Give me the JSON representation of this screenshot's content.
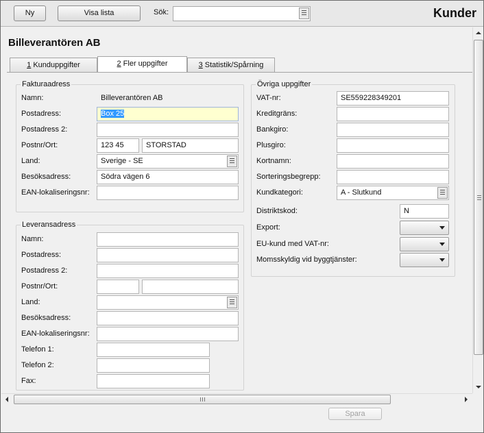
{
  "toolbar": {
    "new_label": "Ny",
    "show_list_label": "Visa lista",
    "search_label": "Sök:",
    "search_value": "",
    "title": "Kunder"
  },
  "customer_name": "Billeverantören AB",
  "tabs": [
    {
      "key": "1",
      "label": " Kunduppgifter"
    },
    {
      "key": "2",
      "label": " Fler uppgifter"
    },
    {
      "key": "3",
      "label": " Statistik/Spårning"
    }
  ],
  "faktura": {
    "title": "Fakturaadress",
    "namn_label": "Namn:",
    "namn_value": "Billeverantören AB",
    "postadress_label": "Postadress:",
    "postadress_value": "Box 25",
    "postadress2_label": "Postadress 2:",
    "postadress2_value": "",
    "postnr_label": "Postnr/Ort:",
    "postnr_value": "123 45",
    "ort_value": "STORSTAD",
    "land_label": "Land:",
    "land_value": "Sverige - SE",
    "besok_label": "Besöksadress:",
    "besok_value": "Södra vägen 6",
    "ean_label": "EAN-lokaliseringsnr:",
    "ean_value": ""
  },
  "leverans": {
    "title": "Leveransadress",
    "namn_label": "Namn:",
    "postadress_label": "Postadress:",
    "postadress2_label": "Postadress 2:",
    "postnr_label": "Postnr/Ort:",
    "land_label": "Land:",
    "besok_label": "Besöksadress:",
    "ean_label": "EAN-lokaliseringsnr:",
    "tel1_label": "Telefon 1:",
    "tel2_label": "Telefon 2:",
    "fax_label": "Fax:"
  },
  "ovriga": {
    "title": "Övriga  uppgifter",
    "vat_label": "VAT-nr:",
    "vat_value": "SE559228349201",
    "kredit_label": "Kreditgräns:",
    "bankgiro_label": "Bankgiro:",
    "plusgiro_label": "Plusgiro:",
    "kortnamn_label": "Kortnamn:",
    "sortering_label": "Sorteringsbegrepp:",
    "kategori_label": "Kundkategori:",
    "kategori_value": "A - Slutkund",
    "distrikt_label": "Distriktskod:",
    "distrikt_value": "N",
    "export_label": "Export:",
    "eu_label": "EU-kund med VAT-nr:",
    "moms_label": "Momsskyldig vid byggtjänster:"
  },
  "footer": {
    "save_label": "Spara"
  },
  "icons": [
    "list-icon",
    "dropdown-arrow-icon",
    "scroll-arrow-icon"
  ]
}
